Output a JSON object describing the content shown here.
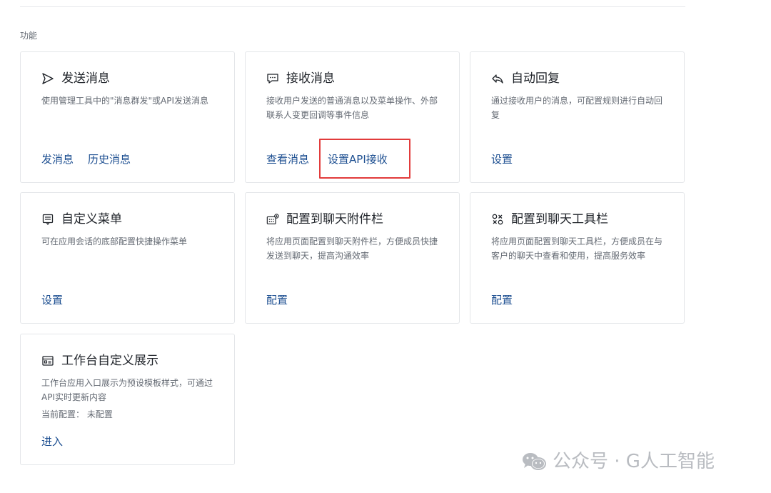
{
  "section": {
    "title": "功能"
  },
  "cards": {
    "send": {
      "title": "发送消息",
      "icon": "send-icon",
      "desc": "使用管理工具中的\"消息群发\"或API发送消息",
      "links": [
        "发消息",
        "历史消息"
      ]
    },
    "receive": {
      "title": "接收消息",
      "icon": "chat-icon",
      "desc": "接收用户发送的普通消息以及菜单操作、外部联系人变更回调等事件信息",
      "links": [
        "查看消息",
        "设置API接收"
      ]
    },
    "auto_reply": {
      "title": "自动回复",
      "icon": "reply-icon",
      "desc": "通过接收用户的消息，可配置规则进行自动回复",
      "links": [
        "设置"
      ]
    },
    "menu": {
      "title": "自定义菜单",
      "icon": "menu-icon",
      "desc": "可在应用会话的底部配置快捷操作菜单",
      "links": [
        "设置"
      ]
    },
    "attachment_bar": {
      "title": "配置到聊天附件栏",
      "icon": "attachment-grid-icon",
      "desc": "将应用页面配置到聊天附件栏，方便成员快捷发送到聊天，提高沟通效率",
      "links": [
        "配置"
      ]
    },
    "toolbar": {
      "title": "配置到聊天工具栏",
      "icon": "tools-icon",
      "desc": "将应用页面配置到聊天工具栏，方便成员在与客户的聊天中查看和使用，提高服务效率",
      "links": [
        "配置"
      ]
    },
    "workbench": {
      "title": "工作台自定义展示",
      "icon": "workbench-icon",
      "desc": "工作台应用入口展示为预设模板样式，可通过API实时更新内容",
      "config": "当前配置： 未配置",
      "links": [
        "进入"
      ]
    }
  },
  "watermark": {
    "text": "公众号 · G人工智能",
    "icon": "wechat-icon"
  },
  "colors": {
    "link": "#1d4f91",
    "highlight": "#e23b3b",
    "text": "#1f2329",
    "muted": "#646a73",
    "border": "#e4e6e9"
  }
}
